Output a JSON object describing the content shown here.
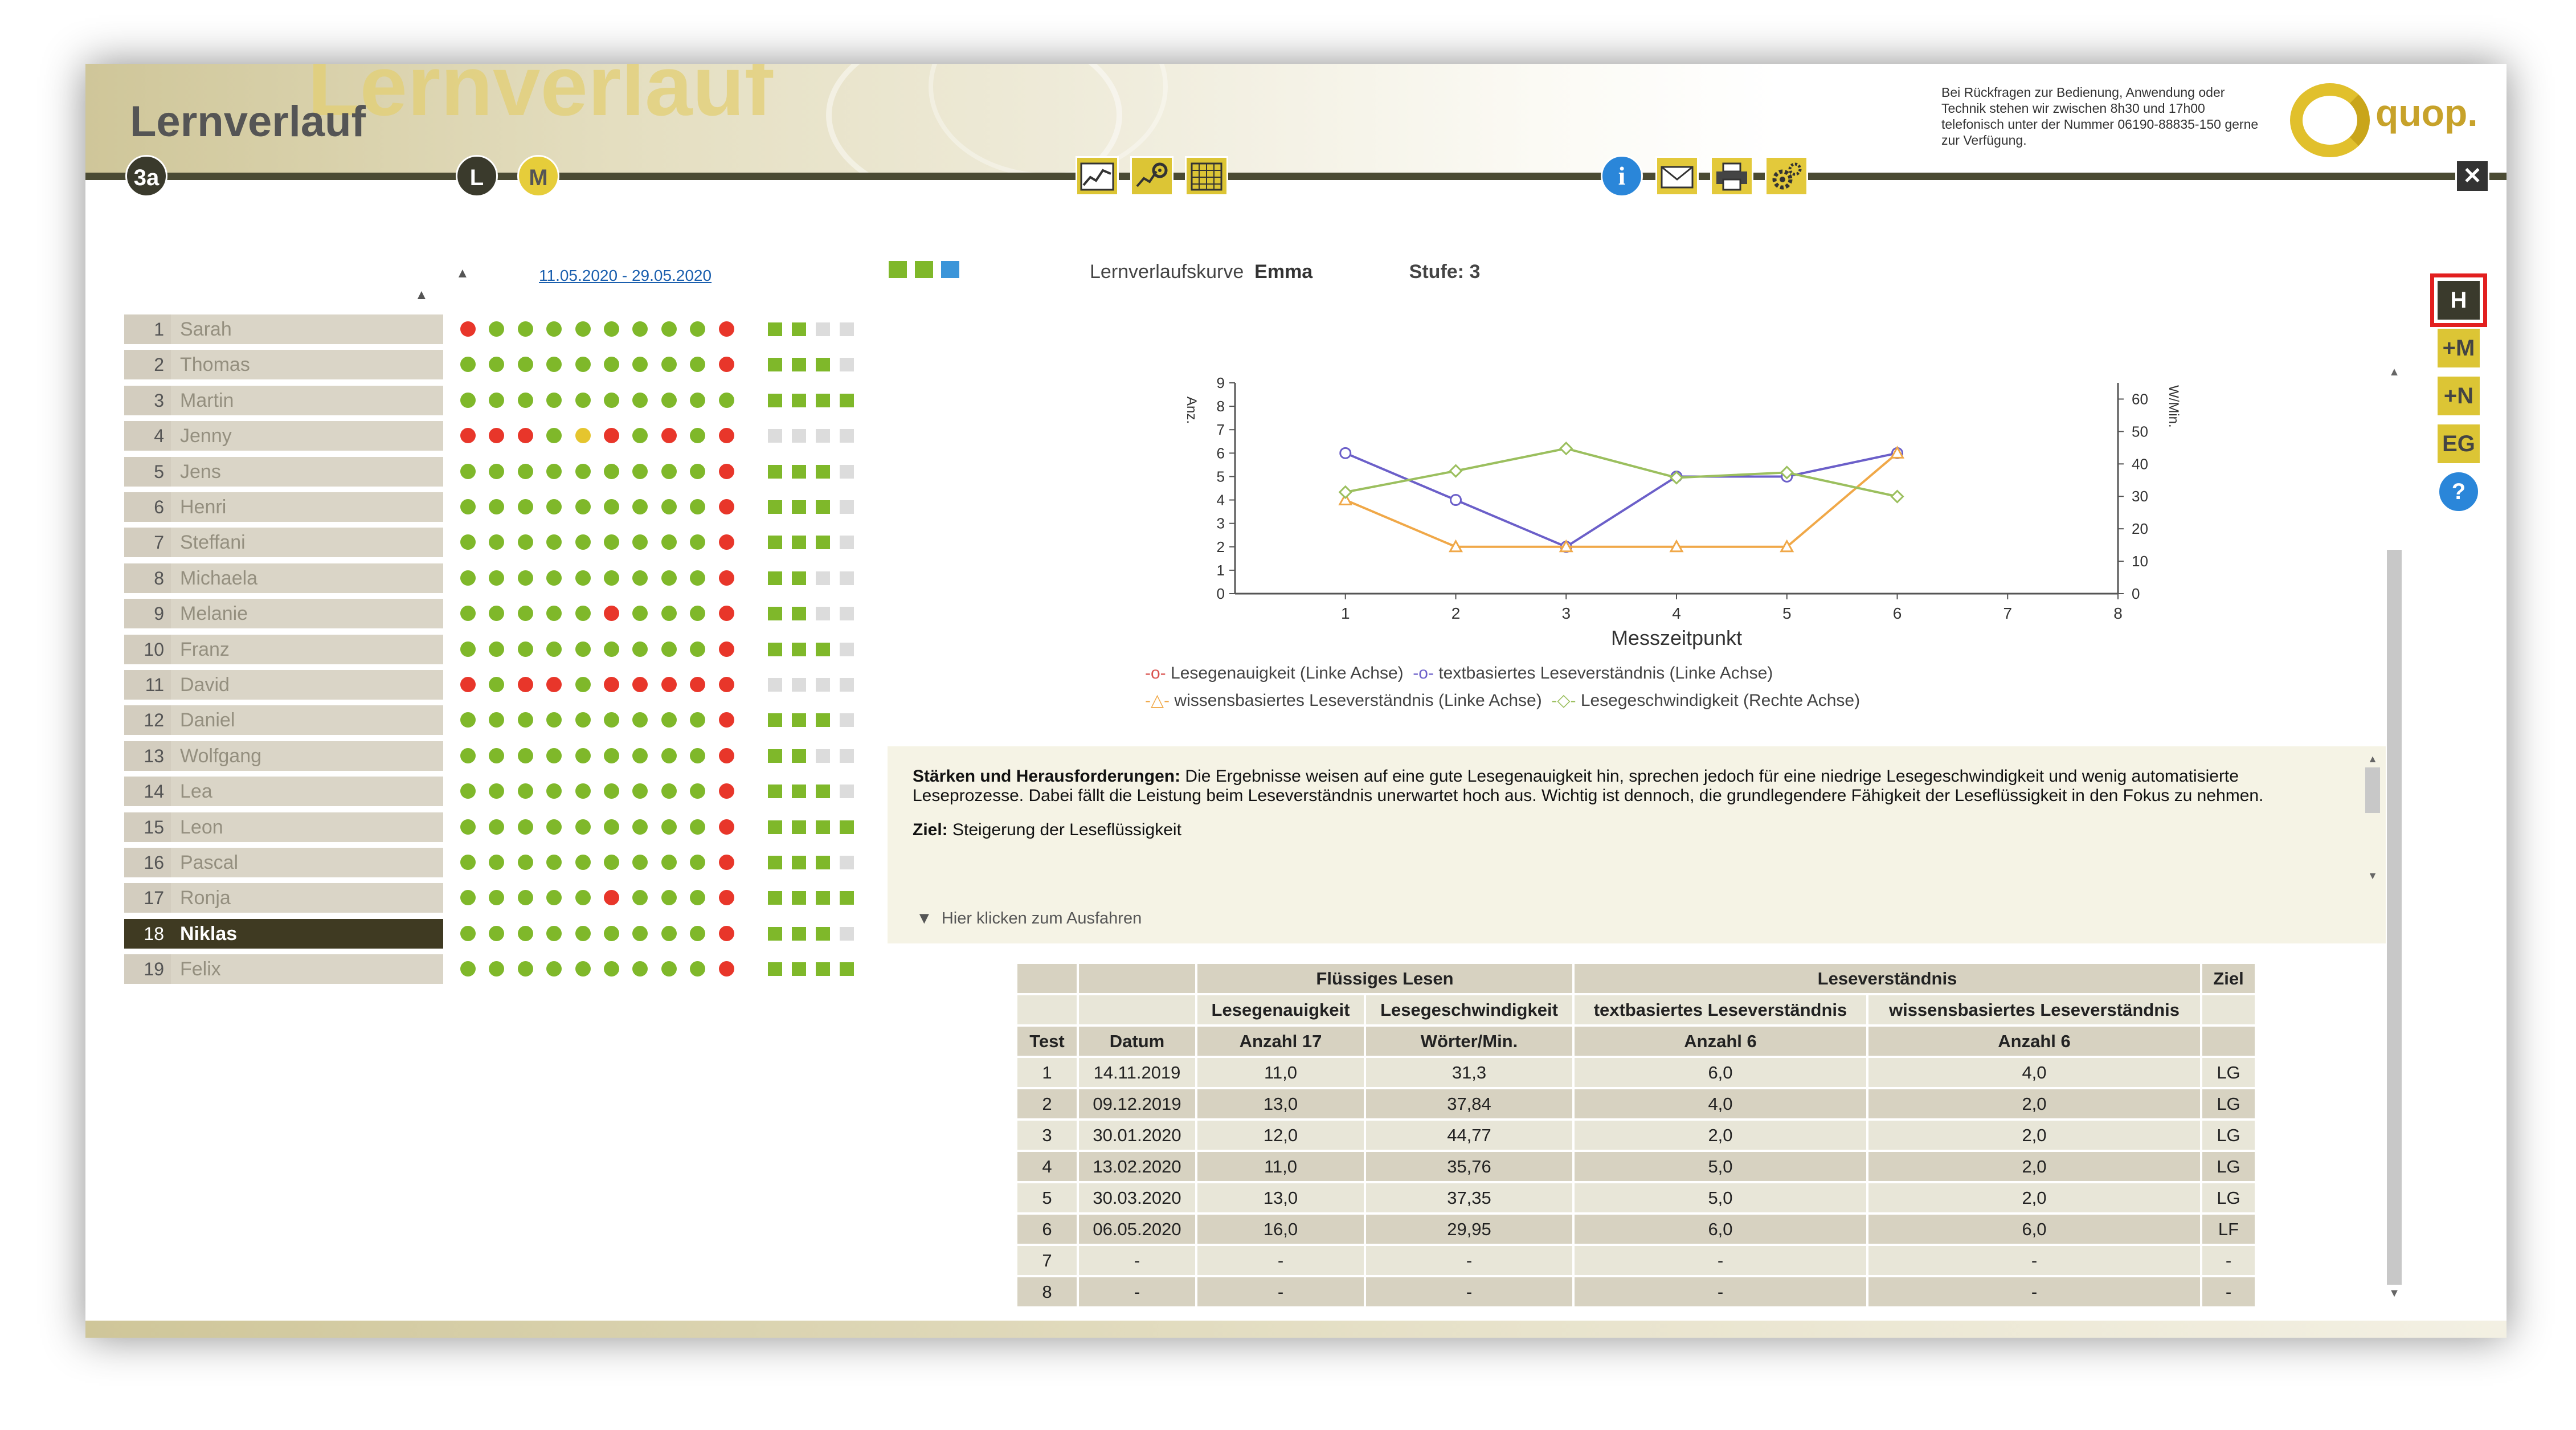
{
  "header": {
    "title": "Lernverlauf",
    "ghost_title": "Lernverlauf",
    "info_text": "Bei Rückfragen zur Bedienung, Anwendung oder Technik stehen wir zwischen 8h30 und 17h00 telefonisch unter der Nummer 06190-88835-150 gerne zur Verfügung.",
    "logo_text": "quop."
  },
  "nav": {
    "class_label": "3a",
    "mode_l": "L",
    "mode_m": "M",
    "icons": [
      "chart-line-icon",
      "chart-settings-icon",
      "calendar-grid-icon",
      "info-icon",
      "mail-icon",
      "print-icon",
      "settings-gear-icon",
      "close-icon"
    ]
  },
  "list": {
    "date_range": "11.05.2020 - 29.05.2020",
    "students": [
      {
        "n": "1",
        "name": "Sarah"
      },
      {
        "n": "2",
        "name": "Thomas"
      },
      {
        "n": "3",
        "name": "Martin"
      },
      {
        "n": "4",
        "name": "Jenny"
      },
      {
        "n": "5",
        "name": "Jens"
      },
      {
        "n": "6",
        "name": "Henri"
      },
      {
        "n": "7",
        "name": "Steffani"
      },
      {
        "n": "8",
        "name": "Michaela"
      },
      {
        "n": "9",
        "name": "Melanie"
      },
      {
        "n": "10",
        "name": "Franz"
      },
      {
        "n": "11",
        "name": "David"
      },
      {
        "n": "12",
        "name": "Daniel"
      },
      {
        "n": "13",
        "name": "Wolfgang"
      },
      {
        "n": "14",
        "name": "Lea"
      },
      {
        "n": "15",
        "name": "Leon"
      },
      {
        "n": "16",
        "name": "Pascal"
      },
      {
        "n": "17",
        "name": "Ronja"
      },
      {
        "n": "18",
        "name": "Niklas"
      },
      {
        "n": "19",
        "name": "Felix"
      }
    ],
    "selected_index": 17,
    "dot_rows": [
      "RGGGGGGGGR",
      "GGGGGGGGGR",
      "GGGGGGGGGG",
      "RRRGYRGRGR",
      "GGGGGGGGGR",
      "GGGGGGGGGR",
      "GGGGGGGGGR",
      "GGGGGGGGGR",
      "GGGGGRGGGR",
      "GGGGGGGGGR",
      "RGRRGRRRRR",
      "GGGGGGGGGR",
      "GGGGGGGGGR",
      "GGGGGGGGGR",
      "GGGGGGGGGR",
      "GGGGGGGGGR",
      "GGGGGRGGGR",
      "GGGGGGGGGR",
      "GGGGGGGGGR"
    ],
    "square_rows": [
      "GGLL",
      "GGGL",
      "GGGG",
      "LLLL",
      "GGGL",
      "GGGL",
      "GGGL",
      "GGLL",
      "GGLL",
      "GGGL",
      "LLLL",
      "GGGL",
      "GGLL",
      "GGGL",
      "GGGG",
      "GGGL",
      "GGGG",
      "GGGL",
      "GGGG"
    ],
    "colors": {
      "G": "#7fb82a",
      "R": "#e8362a",
      "Y": "#e5c52e",
      "L": "#dcdcdc"
    }
  },
  "chart_header": {
    "label": "Lernverlaufskurve",
    "student": "Emma",
    "level_label": "Stufe: 3"
  },
  "chart_data": {
    "type": "line",
    "xlabel": "Messzeitpunkt",
    "ylabel_left": "Anz.",
    "ylabel_right": "W/Min.",
    "x": [
      1,
      2,
      3,
      4,
      5,
      6,
      7,
      8
    ],
    "xlim": [
      0,
      8
    ],
    "ylim_left": [
      0,
      9
    ],
    "ylim_right": [
      0,
      65
    ],
    "yticks_left": [
      0,
      1,
      2,
      3,
      4,
      5,
      6,
      7,
      8,
      9
    ],
    "yticks_right": [
      0,
      10,
      20,
      30,
      40,
      50,
      60
    ],
    "series": [
      {
        "name": "Lesegenauigkeit (Linke Achse)",
        "axis": "left",
        "color": "#d9534f",
        "marker": "circle",
        "values": []
      },
      {
        "name": "textbasiertes Leseverständnis (Linke Achse)",
        "axis": "left",
        "color": "#6b5fc9",
        "marker": "circle",
        "values": [
          6,
          4,
          2,
          5,
          5,
          6
        ]
      },
      {
        "name": "wissensbasiertes Leseverständnis (Linke Achse)",
        "axis": "left",
        "color": "#f0a848",
        "marker": "triangle",
        "values": [
          4,
          2,
          2,
          2,
          2,
          6
        ]
      },
      {
        "name": "Lesegeschwindigkeit (Rechte Achse)",
        "axis": "right",
        "color": "#9bbf5e",
        "marker": "diamond",
        "values": [
          31.3,
          37.84,
          44.77,
          35.76,
          37.35,
          29.95
        ]
      }
    ],
    "legend": "bottom"
  },
  "panel": {
    "strengths_label": "Stärken und Herausforderungen:",
    "strengths_text": "Die Ergebnisse weisen auf eine gute Lesegenauigkeit hin, sprechen jedoch für eine niedrige Lesegeschwindigkeit und wenig automatisierte Leseprozesse. Dabei fällt die Leistung beim Leseverständnis unerwartet hoch aus. Wichtig ist dennoch, die grundlegendere Fähigkeit der Leseflüssigkeit in den Fokus zu nehmen.",
    "goal_label": "Ziel:",
    "goal_text": "Steigerung der Leseflüssigkeit",
    "expand_label": "Hier klicken zum Ausfahren"
  },
  "table": {
    "group_fluent": "Flüssiges Lesen",
    "group_comprehension": "Leseverständnis",
    "col_goal": "Ziel",
    "col_accuracy": "Lesegenauigkeit",
    "col_speed": "Lesegeschwindigkeit",
    "col_text": "textbasiertes Leseverständnis",
    "col_knowledge": "wissensbasiertes Leseverständnis",
    "col_test": "Test",
    "col_date": "Datum",
    "unit_accuracy": "Anzahl 17",
    "unit_speed": "Wörter/Min.",
    "unit_text": "Anzahl 6",
    "unit_knowledge": "Anzahl 6",
    "rows": [
      [
        "1",
        "14.11.2019",
        "11,0",
        "31,3",
        "6,0",
        "4,0",
        "LG"
      ],
      [
        "2",
        "09.12.2019",
        "13,0",
        "37,84",
        "4,0",
        "2,0",
        "LG"
      ],
      [
        "3",
        "30.01.2020",
        "12,0",
        "44,77",
        "2,0",
        "2,0",
        "LG"
      ],
      [
        "4",
        "13.02.2020",
        "11,0",
        "35,76",
        "5,0",
        "2,0",
        "LG"
      ],
      [
        "5",
        "30.03.2020",
        "13,0",
        "37,35",
        "5,0",
        "2,0",
        "LG"
      ],
      [
        "6",
        "06.05.2020",
        "16,0",
        "29,95",
        "6,0",
        "6,0",
        "LF"
      ],
      [
        "7",
        "-",
        "-",
        "-",
        "-",
        "-",
        "-"
      ],
      [
        "8",
        "-",
        "-",
        "-",
        "-",
        "-",
        "-"
      ]
    ]
  },
  "sidebar": {
    "buttons": [
      "H",
      "+M",
      "+N",
      "EG",
      "?"
    ]
  }
}
